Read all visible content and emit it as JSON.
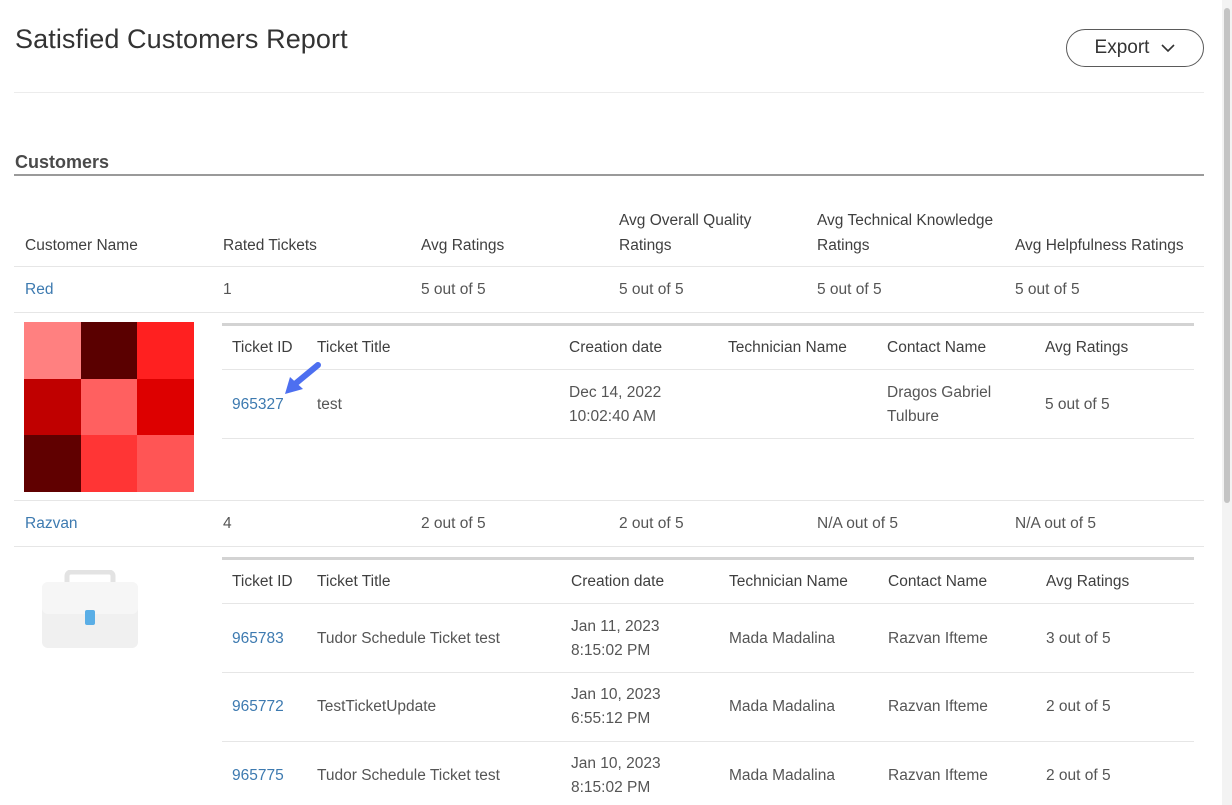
{
  "page": {
    "title": "Satisfied Customers Report",
    "export_label": "Export"
  },
  "section": {
    "title": "Customers"
  },
  "columns": {
    "customer_name": "Customer Name",
    "rated_tickets": "Rated Tickets",
    "avg_ratings": "Avg Ratings",
    "avg_overall_quality_line1": "Avg Overall Quality",
    "avg_overall_quality_line2": "Ratings",
    "avg_technical_knowledge_line1": "Avg Technical Knowledge",
    "avg_technical_knowledge_line2": "Ratings",
    "avg_helpfulness": "Avg Helpfulness Ratings"
  },
  "ticket_columns": {
    "ticket_id": "Ticket ID",
    "ticket_title": "Ticket Title",
    "creation_date": "Creation date",
    "technician_name": "Technician Name",
    "contact_name": "Contact Name",
    "avg_ratings": "Avg Ratings"
  },
  "customers": [
    {
      "name": "Red",
      "rated_tickets": "1",
      "avg_ratings": "5 out of 5",
      "avg_overall_quality": "5 out of 5",
      "avg_technical_knowledge": "5 out of 5",
      "avg_helpfulness": "5 out of 5",
      "avatar_colors": [
        "#ff8080",
        "#5a0000",
        "#ff2020",
        "#c00000",
        "#ff6060",
        "#dd0000",
        "#600000",
        "#ff3535",
        "#ff5555"
      ],
      "tickets": [
        {
          "id": "965327",
          "title": "test",
          "date_line1": "Dec 14, 2022",
          "date_line2": "10:02:40 AM",
          "technician": "",
          "contact_line1": "Dragos Gabriel",
          "contact_line2": "Tulbure",
          "avg_ratings": "5 out of 5"
        }
      ]
    },
    {
      "name": "Razvan",
      "rated_tickets": "4",
      "avg_ratings": "2 out of 5",
      "avg_overall_quality": "2 out of 5",
      "avg_technical_knowledge": "N/A out of 5",
      "avg_helpfulness": "N/A out of 5",
      "avatar_icon": "briefcase-icon",
      "tickets": [
        {
          "id": "965783",
          "title": "Tudor Schedule Ticket test",
          "date_line1": "Jan 11, 2023",
          "date_line2": "8:15:02 PM",
          "technician": "Mada Madalina",
          "contact": "Razvan Ifteme",
          "avg_ratings": "3 out of 5"
        },
        {
          "id": "965772",
          "title": "TestTicketUpdate",
          "date_line1": "Jan 10, 2023",
          "date_line2": "6:55:12 PM",
          "technician": "Mada Madalina",
          "contact": "Razvan Ifteme",
          "avg_ratings": "2 out of 5"
        },
        {
          "id": "965775",
          "title": "Tudor Schedule Ticket test",
          "date_line1": "Jan 10, 2023",
          "date_line2": "8:15:02 PM",
          "technician": "Mada Madalina",
          "contact": "Razvan Ifteme",
          "avg_ratings": "2 out of 5"
        }
      ]
    }
  ],
  "colors": {
    "link": "#3d7ab0",
    "pointer": "#4d6ff0"
  }
}
